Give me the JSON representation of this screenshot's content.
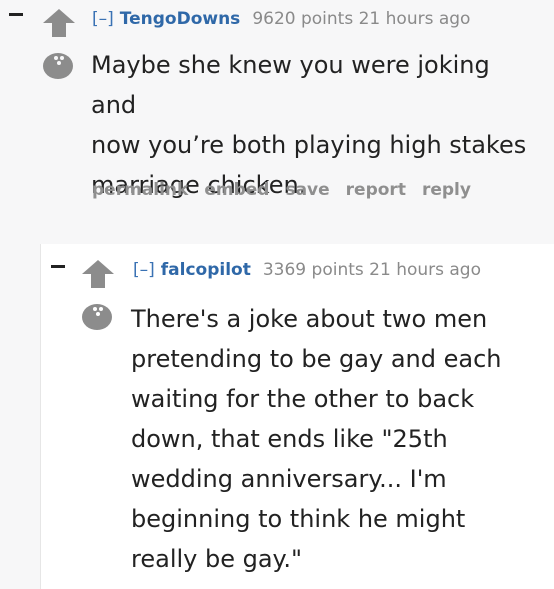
{
  "comments": [
    {
      "collapse": "[–]",
      "author": "TengoDowns",
      "points": "9620 points",
      "time": "21 hours ago",
      "body": "Maybe she knew you were joking and\nnow you’re both playing high stakes\nmarriage chicken.",
      "actions": [
        "permalink",
        "embed",
        "save",
        "report",
        "reply"
      ]
    },
    {
      "collapse": "[–]",
      "author": "falcopilot",
      "points": "3369 points",
      "time": "21 hours ago",
      "body": "There's a joke about two men\npretending to be gay and each\nwaiting for the other to back\ndown, that ends like \"25th\nwedding anniversary... I'm\nbeginning to think he might\nreally be gay.\""
    }
  ],
  "icons": {
    "upvote": "up-arrow-icon",
    "downvote": "bowling-ball-icon",
    "collapse": "minus-icon"
  },
  "colors": {
    "author": "#2f68a8",
    "meta": "#8a8a8a",
    "arrow": "#8c8c8c"
  }
}
